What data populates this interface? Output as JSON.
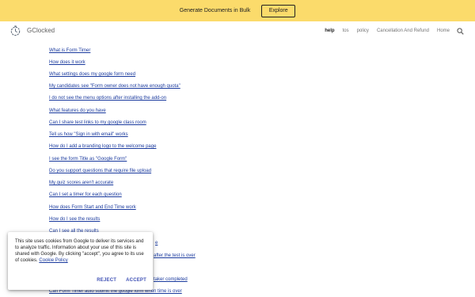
{
  "banner": {
    "text": "Generate Documents in Bulk",
    "button_label": "Explore"
  },
  "header": {
    "site_name": "GClocked",
    "logo_icon": "stopwatch-icon",
    "nav": [
      {
        "label": "help",
        "active": true
      },
      {
        "label": "tos",
        "active": false
      },
      {
        "label": "policy",
        "active": false
      },
      {
        "label": "Cancellation And Refund",
        "active": false
      },
      {
        "label": "Home",
        "active": false
      }
    ],
    "search_icon": "search-icon"
  },
  "faq": {
    "items": [
      {
        "label": "What is Form Timer"
      },
      {
        "label": "How does it work"
      },
      {
        "label": "What settings does my google form need"
      },
      {
        "label": "My candidates see \"Form owner does not have enough quota\""
      },
      {
        "label": "I do not see the menu options after installing the add-on"
      },
      {
        "label": "What features do you have"
      },
      {
        "label": "Can I share test links to my google class room"
      },
      {
        "label": "Tell us how \"Sign in with email\" works"
      },
      {
        "label": "How do I add a branding logo to the welcome page"
      },
      {
        "label": "I see the form Title as \"Google Form\""
      },
      {
        "label": "Do you support questions that require file upload"
      },
      {
        "label": "My quiz scores aren't accurate"
      },
      {
        "label": "Can I set a timer for each question"
      },
      {
        "label": "How does Form Start and End Time work"
      },
      {
        "label": "How do I see the results"
      },
      {
        "label": "Can I see all the results"
      },
      {
        "label": "e"
      },
      {
        "label": "after the test is over"
      },
      {
        "label": ""
      },
      {
        "label": "taker completed"
      },
      {
        "label": "Can Form Timer auto submit the google form when time is over"
      }
    ]
  },
  "cookie_notice": {
    "text": "This site uses cookies from Google to deliver its services and to analyze traffic. Information about your use of this site is shared with Google. By clicking \"accept\", you agree to its use of cookies.",
    "policy_link": "Cookie Policy",
    "reject_label": "REJECT",
    "accept_label": "ACCEPT"
  },
  "colors": {
    "banner_bg": "#fbdb6b",
    "link": "#1a3a9e",
    "button_accent": "#3f51b5"
  }
}
